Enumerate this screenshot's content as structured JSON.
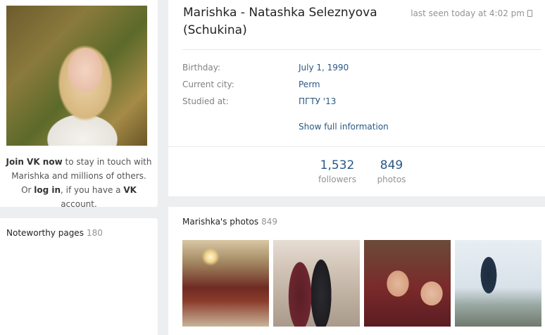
{
  "join": {
    "join_vk": "Join VK now",
    "line1_rest": " to stay in touch with",
    "line2": "Marishka and millions of others.",
    "or": "Or ",
    "log_in": "log in",
    "if_have": ", if you have a ",
    "vk": "VK",
    "account": " account."
  },
  "noteworthy": {
    "label": "Noteworthy pages",
    "count": "180"
  },
  "profile": {
    "name": "Marishka - Natashka Seleznyova (Schukina)",
    "last_seen": "last seen today at 4:02 pm",
    "info": [
      {
        "label": "Birthday:",
        "value": "July 1, 1990"
      },
      {
        "label": "Current city:",
        "value": "Perm"
      },
      {
        "label": "Studied at:",
        "value": "ПГТУ '13"
      }
    ],
    "show_full": "Show full information",
    "counters": [
      {
        "num": "1,532",
        "label": "followers"
      },
      {
        "num": "849",
        "label": "photos"
      }
    ]
  },
  "photos": {
    "title": "Marishka's photos",
    "count": "849"
  },
  "icons": {
    "phone": "mobile-phone-icon"
  }
}
